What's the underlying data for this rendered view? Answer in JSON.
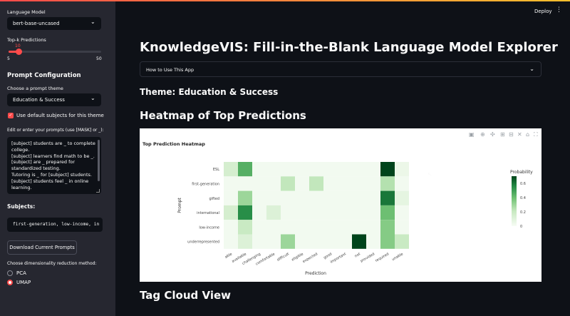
{
  "sidebar": {
    "language_model_label": "Language Model",
    "language_model_value": "bert-base-uncased",
    "topk_label": "Top-k Predictions",
    "topk_value": "10",
    "topk_min": "5",
    "topk_max": "50",
    "topk_fraction": 0.11,
    "prompt_config_title": "Prompt Configuration",
    "theme_label": "Choose a prompt theme",
    "theme_value": "Education & Success",
    "default_subjects_label": "Use default subjects for this theme",
    "default_subjects_checked": true,
    "prompts_label": "Edit or enter your prompts (use [MASK] or _):",
    "prompts_lines": [
      "[subject] students are _ to complete college.",
      "[subject] learners find math to be _.",
      "[subject] are _ prepared for standardized testing.",
      "Tutoring is _ for [subject] students.",
      "[subject] students feel _ in online learning."
    ],
    "subjects_label": "Subjects:",
    "subjects_value": "first-generation, low-income, in",
    "download_button": "Download Current Prompts",
    "dimred_label": "Choose dimensionality reduction method:",
    "dimred_options": [
      "PCA",
      "UMAP"
    ],
    "dimred_selected": "UMAP"
  },
  "header": {
    "deploy": "Deploy",
    "menu_icon": "kebab-menu-icon"
  },
  "main": {
    "title": "KnowledgeVIS: Fill-in-the-Blank Language Model Explorer",
    "expander": "How to Use This App",
    "theme_heading": "Theme: Education & Success",
    "heatmap_heading": "Heatmap of Top Predictions",
    "tagcloud_heading": "Tag Cloud View"
  },
  "colors": {
    "accent": "#ff4b4b",
    "sidebar": "#262730",
    "bg": "#0e1117",
    "heat_dark": "#00441b",
    "heat_light": "#f7fcf5"
  },
  "chart_data": {
    "type": "heatmap",
    "title": "Top Prediction Heatmap",
    "xlabel": "Prediction",
    "ylabel": "Prompt",
    "colorbar_title": "Probability",
    "colorbar_ticks": [
      "0",
      "0.2",
      "0.4",
      "0.6"
    ],
    "zlim": [
      0,
      0.7
    ],
    "y": [
      "ESL",
      "first-generation",
      "gifted",
      "international",
      "low-income",
      "underrepresented"
    ],
    "x": [
      "able",
      "available",
      "challenging",
      "comfortable",
      "difficult",
      "eligible",
      "expected",
      "good",
      "important",
      "not",
      "provided",
      "required",
      "unable"
    ],
    "z": [
      [
        0.15,
        0.45,
        0.02,
        0.02,
        0.02,
        0.02,
        0.02,
        0.02,
        0.02,
        0.02,
        0.02,
        0.72,
        0.05
      ],
      [
        0.02,
        0.02,
        0.02,
        0.02,
        0.22,
        0.02,
        0.22,
        0.02,
        0.02,
        0.02,
        0.02,
        0.25,
        0.02
      ],
      [
        0.02,
        0.3,
        0.02,
        0.02,
        0.02,
        0.02,
        0.02,
        0.02,
        0.02,
        0.02,
        0.02,
        0.6,
        0.08
      ],
      [
        0.15,
        0.55,
        0.02,
        0.12,
        0.02,
        0.02,
        0.02,
        0.02,
        0.02,
        0.02,
        0.02,
        0.4,
        0.02
      ],
      [
        0.02,
        0.2,
        0.02,
        0.02,
        0.02,
        0.02,
        0.02,
        0.02,
        0.02,
        0.02,
        0.02,
        0.35,
        0.02
      ],
      [
        0.02,
        0.12,
        0.02,
        0.02,
        0.3,
        0.02,
        0.02,
        0.02,
        0.02,
        0.85,
        0.02,
        0.35,
        0.2
      ]
    ]
  }
}
